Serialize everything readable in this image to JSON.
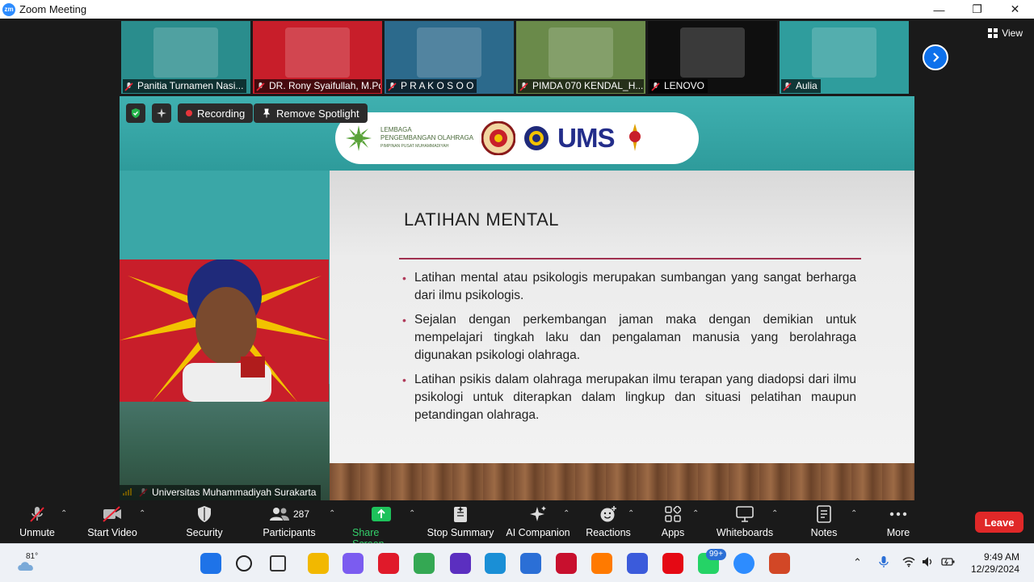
{
  "window": {
    "app_icon_text": "zm",
    "title": "Zoom Meeting",
    "minimize": "—",
    "restore": "❐",
    "close": "✕"
  },
  "view_button": {
    "label": "View"
  },
  "thumbnails": [
    {
      "name": "Panitia Turnamen Nasi...",
      "bg": "#2a8d8d",
      "muted": true
    },
    {
      "name": "DR. Rony Syaifullah, M.Pd...",
      "bg": "#c81e2a",
      "muted": true
    },
    {
      "name": "P R A K O S O O",
      "bg": "#2c6a8c",
      "muted": true
    },
    {
      "name": "PIMDA 070 KENDAL_H...",
      "bg": "#6a8a4a",
      "muted": true
    },
    {
      "name": "LENOVO",
      "bg": "#0f0f0f",
      "muted": true
    },
    {
      "name": "Aulia",
      "bg": "#2f9d9d",
      "muted": true
    }
  ],
  "share_overlay": {
    "recording_label": "Recording",
    "spotlight_label": "Remove Spotlight"
  },
  "slide": {
    "logos": {
      "lpo_line1": "LEMBAGA",
      "lpo_line2": "PENGEMBANGAN OLAHRAGA",
      "lpo_line3": "PIMPINAN PUSAT MUHAMMADIYAH",
      "ums": "UMS"
    },
    "title": "LATIHAN MENTAL",
    "bullets": [
      "Latihan mental  atau psikologis merupakan sumbangan yang  sangat berharga dari ilmu psikologis.",
      "Sejalan dengan perkembangan  jaman maka dengan demikian untuk mempelajari tingkah laku dan pengalaman manusia yang berolahraga digunakan psikologi olahraga.",
      "Latihan psikis dalam olahraga merupakan ilmu terapan yang diadopsi dari ilmu psikologi untuk diterapkan dalam lingkup dan situasi pelatihan maupun petandingan olahraga."
    ]
  },
  "active_speaker": {
    "name": "Universitas Muhammadiyah Surakarta"
  },
  "toolbar": {
    "unmute": "Unmute",
    "start_video": "Start Video",
    "security": "Security",
    "participants": "Participants",
    "participants_count": "287",
    "share_screen": "Share Screen",
    "stop_summary": "Stop Summary",
    "ai_companion": "AI Companion",
    "reactions": "Reactions",
    "apps": "Apps",
    "whiteboards": "Whiteboards",
    "notes": "Notes",
    "more": "More",
    "leave": "Leave"
  },
  "taskbar": {
    "weather_temp": "81°",
    "whatsapp_badge": "99+",
    "time": "9:49 AM",
    "date": "12/29/2024",
    "apps": [
      {
        "name": "start",
        "color": "#1e73e8"
      },
      {
        "name": "search",
        "color": "#222222"
      },
      {
        "name": "task-view",
        "color": "#333333"
      },
      {
        "name": "file-explorer",
        "color": "#f2b800"
      },
      {
        "name": "copilot",
        "color": "#7b5cf0"
      },
      {
        "name": "opera",
        "color": "#e01a2a"
      },
      {
        "name": "chrome",
        "color": "#34a853"
      },
      {
        "name": "visual-studio",
        "color": "#5b2fc0"
      },
      {
        "name": "edge",
        "color": "#1a8fd6"
      },
      {
        "name": "microsoft-store",
        "color": "#2b6fd6"
      },
      {
        "name": "mcafee",
        "color": "#c8102e"
      },
      {
        "name": "firefox",
        "color": "#ff7a00"
      },
      {
        "name": "app-blue",
        "color": "#3b5bdb"
      },
      {
        "name": "netflix",
        "color": "#e50914"
      },
      {
        "name": "whatsapp",
        "color": "#25d366"
      },
      {
        "name": "zoom",
        "color": "#2d8cff"
      },
      {
        "name": "powerpoint",
        "color": "#d24726"
      }
    ]
  }
}
